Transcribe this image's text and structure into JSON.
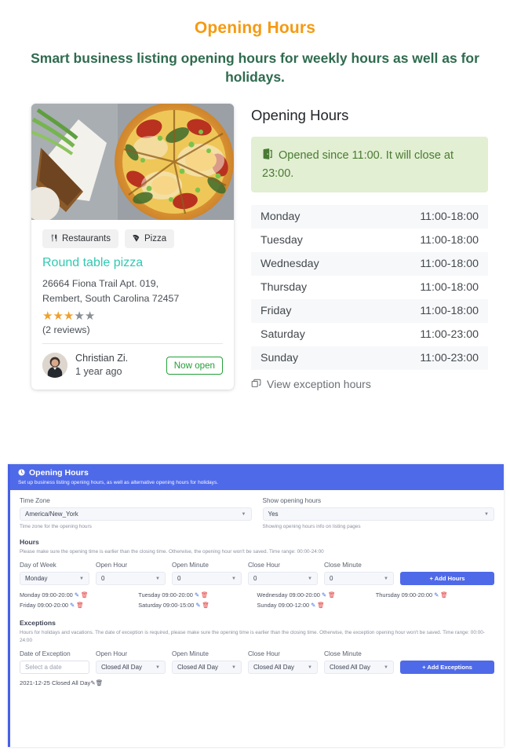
{
  "hero": {
    "title": "Opening Hours",
    "subtitle": "Smart business listing opening hours for weekly hours as well as for holidays.",
    "title_color": "#f59a12",
    "subtitle_color": "#2f6b4f"
  },
  "listing_card": {
    "photo_alt": "pizza-photo",
    "tags": [
      {
        "icon": "utensils-icon",
        "glyph": "🍴",
        "label": "Restaurants"
      },
      {
        "icon": "pizza-slice-icon",
        "glyph": "🍕",
        "label": "Pizza"
      }
    ],
    "name": "Round table pizza",
    "name_color": "#31c9b1",
    "address_line1": "26664 Fiona Trail Apt. 019,",
    "address_line2": "Rembert, South Carolina 72457",
    "rating": 3,
    "rating_max": 5,
    "star_on_color": "#f0a02a",
    "star_off_color": "#8a8f94",
    "reviews_text": "(2 reviews)",
    "review": {
      "author": "Christian Zi.",
      "time": "1 year ago",
      "badge": "Now open",
      "badge_color": "#23a038"
    }
  },
  "opening_hours_panel": {
    "title": "Opening Hours",
    "status_icon": "door-open-icon",
    "status_text": "Opened since 11:00. It will close at 23:00.",
    "status_bg": "#e2efd3",
    "status_color": "#4a7a33",
    "rows": [
      {
        "day": "Monday",
        "time": "11:00-18:00"
      },
      {
        "day": "Tuesday",
        "time": "11:00-18:00"
      },
      {
        "day": "Wednesday",
        "time": "11:00-18:00"
      },
      {
        "day": "Thursday",
        "time": "11:00-18:00"
      },
      {
        "day": "Friday",
        "time": "11:00-18:00"
      },
      {
        "day": "Saturday",
        "time": "11:00-23:00"
      },
      {
        "day": "Sunday",
        "time": "11:00-23:00"
      }
    ],
    "exception_link_icon": "copy-icon",
    "exception_link": "View exception hours"
  },
  "admin": {
    "header": {
      "icon": "clock-icon",
      "title": "Opening Hours",
      "subtitle": "Set up business listing opening hours, as well as alternative opening hours for holidays.",
      "bg_color": "#4f6ae8"
    },
    "timezone": {
      "label": "Time Zone",
      "value": "America/New_York",
      "help": "Time zone for the opening hours"
    },
    "show_opening_hours": {
      "label": "Show opening hours",
      "value": "Yes",
      "help": "Showing opening hours info on listing pages"
    },
    "hours_section": {
      "title": "Hours",
      "note": "Please make sure the opening time is earlier than the closing time. Otherwise, the opening hour won't be saved. Time range: 00:00-24:00",
      "fields": [
        {
          "label": "Day of Week",
          "value": "Monday"
        },
        {
          "label": "Open Hour",
          "value": "0"
        },
        {
          "label": "Open Minute",
          "value": "0"
        },
        {
          "label": "Close Hour",
          "value": "0"
        },
        {
          "label": "Close Minute",
          "value": "0"
        }
      ],
      "add_button": "+ Add Hours",
      "entries": [
        "Monday 09:00-20:00",
        "Tuesday 09:00-20:00",
        "Wednesday 09:00-20:00",
        "Thursday 09:00-20:00",
        "Friday 09:00-20:00",
        "Saturday 09:00-15:00",
        "Sunday 09:00-12:00"
      ]
    },
    "exceptions_section": {
      "title": "Exceptions",
      "note": "Hours for holidays and vacations. The date of exception is required, please make sure the opening time is earlier than the closing time. Otherwise, the exception opening hour won't be saved. Time range: 00:00-24:00",
      "fields": [
        {
          "label": "Date of Exception",
          "value": "Select a date"
        },
        {
          "label": "Open Hour",
          "value": "Closed All Day"
        },
        {
          "label": "Open Minute",
          "value": "Closed All Day"
        },
        {
          "label": "Close Hour",
          "value": "Closed All Day"
        },
        {
          "label": "Close Minute",
          "value": "Closed All Day"
        }
      ],
      "add_button": "+ Add Exceptions",
      "entries": [
        "2021-12-25 Closed All Day"
      ]
    }
  }
}
